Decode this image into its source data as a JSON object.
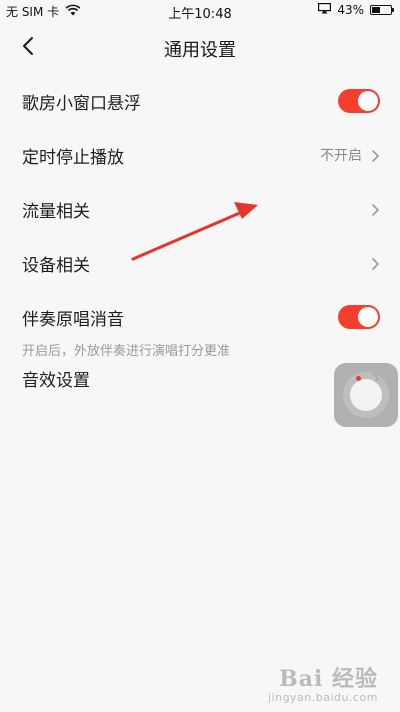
{
  "status_bar": {
    "carrier": "无 SIM 卡",
    "time": "上午10:48",
    "battery_percent": "43%",
    "battery_level": 0.43,
    "wifi_icon": "wifi-icon",
    "screen_mirror_icon": "screen-mirror-icon"
  },
  "header": {
    "title": "通用设置",
    "back_icon": "chevron-left-icon"
  },
  "settings": {
    "floating_window": {
      "label": "歌房小窗口悬浮",
      "enabled": true
    },
    "timer_stop": {
      "label": "定时停止播放",
      "value": "不开启"
    },
    "traffic": {
      "label": "流量相关"
    },
    "device": {
      "label": "设备相关"
    },
    "vocal_removal": {
      "label": "伴奏原唱消音",
      "hint": "开启后，外放伴奏进行演唱打分更准",
      "enabled": true
    },
    "sound_effect": {
      "label": "音效设置"
    }
  },
  "colors": {
    "accent": "#f43f2f",
    "background": "#f7f7f7",
    "annotation_arrow": "#e8332a"
  },
  "watermark": {
    "main": "Bai 经验",
    "sub": "jingyan.baidu.com"
  }
}
